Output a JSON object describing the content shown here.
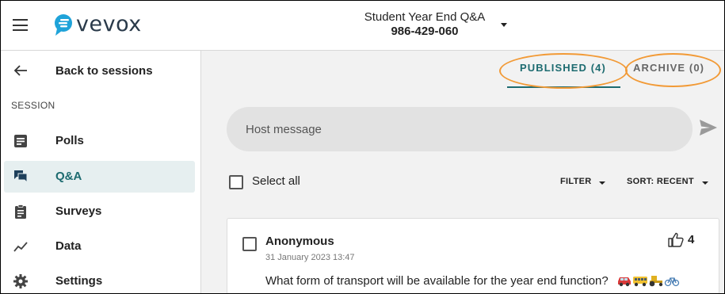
{
  "header": {
    "app_name": "vevox",
    "session_name": "Student Year End Q&A",
    "session_code": "986-429-060"
  },
  "sidebar": {
    "back_label": "Back to sessions",
    "section_label": "SESSION",
    "items": [
      {
        "label": "Polls",
        "icon": "polls-icon",
        "active": false
      },
      {
        "label": "Q&A",
        "icon": "qa-icon",
        "active": true
      },
      {
        "label": "Surveys",
        "icon": "surveys-icon",
        "active": false
      },
      {
        "label": "Data",
        "icon": "data-icon",
        "active": false
      },
      {
        "label": "Settings",
        "icon": "settings-icon",
        "active": false
      }
    ]
  },
  "main": {
    "tabs": [
      {
        "label": "PUBLISHED (4)",
        "active": true
      },
      {
        "label": "ARCHIVE (0)",
        "active": false
      }
    ],
    "host_message_placeholder": "Host message",
    "select_all_label": "Select all",
    "filter_label": "FILTER",
    "sort_label": "SORT: RECENT",
    "questions": [
      {
        "author": "Anonymous",
        "date": "31 January 2023 13:47",
        "text": "What form of transport will be available for the year end function?",
        "likes": "4",
        "emojis": [
          "car-emoji",
          "bus-emoji",
          "tractor-emoji",
          "bicycle-emoji"
        ]
      }
    ]
  },
  "colors": {
    "accent": "#1d6b70",
    "annotation_highlight": "#f29a36",
    "active_nav_bg": "#e6eff0",
    "main_bg": "#f2f2f2"
  }
}
